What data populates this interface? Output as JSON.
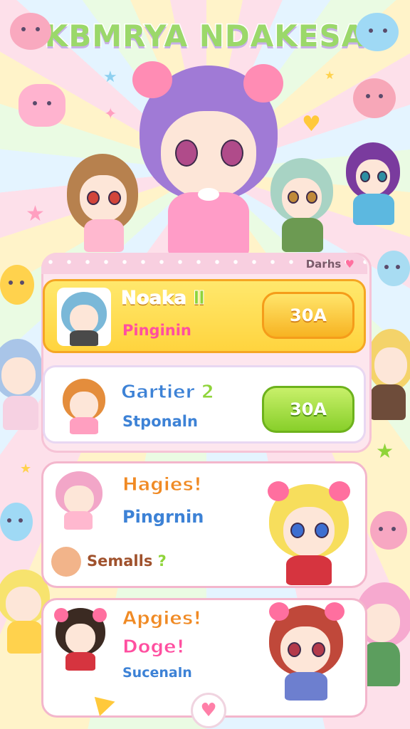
{
  "game": {
    "title": "KBMRYA NDAKESA",
    "panel_tag": "Darhs",
    "panel_tag_icon": "heart-icon"
  },
  "rows": [
    {
      "name": "Noaka",
      "name_suffix": "Ⅱ",
      "subtitle": "Pinginin",
      "button": "30A",
      "name_color": "#ffffff",
      "sub_color": "#ff4fa0",
      "button_color": "#ffc93b"
    },
    {
      "name": "Gartier",
      "name_suffix": "2",
      "subtitle": "Stponaln",
      "button": "30A",
      "name_color": "#3d82d6",
      "sub_color": "#3d82d6",
      "button_color": "#8fd43a"
    }
  ],
  "cards": [
    {
      "name": "Hagies!",
      "subtitle": "Pingrnin",
      "extra": "Semalls",
      "extra_suffix": "?"
    },
    {
      "name": "Apgies!",
      "subtitle": "Doge!",
      "extra": "Sucenaln"
    }
  ],
  "colors": {
    "accent_pink": "#ff6f9f",
    "accent_yellow": "#ffd43e",
    "accent_green": "#8fd43a",
    "accent_blue": "#3d82d6"
  }
}
